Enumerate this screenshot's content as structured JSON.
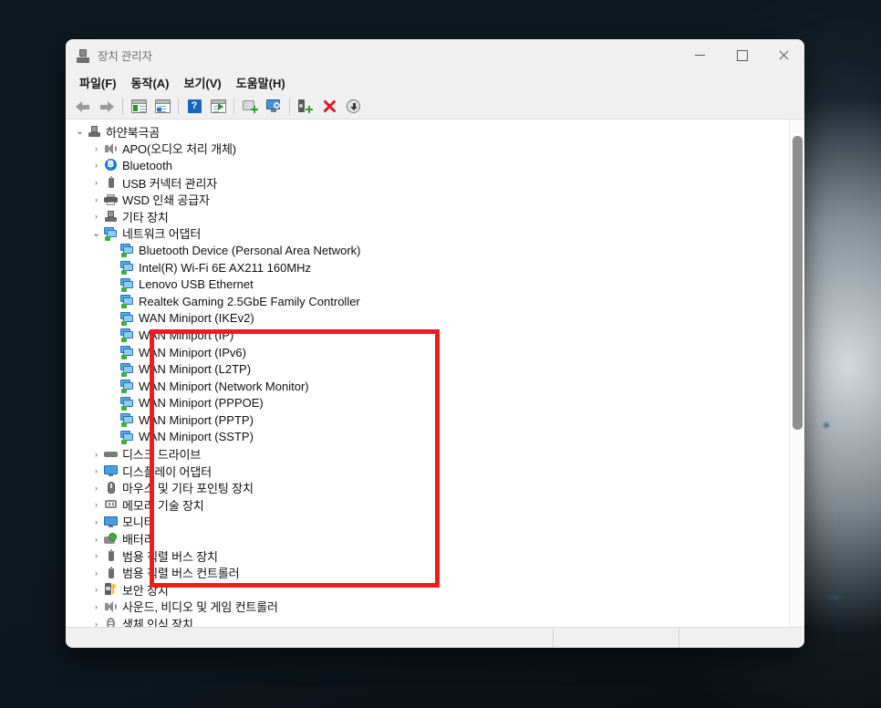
{
  "window": {
    "title": "장치 관리자",
    "title_icon": "device-manager-icon",
    "caption": {
      "minimize_label": "최소화",
      "maximize_label": "최대화",
      "close_label": "닫기"
    }
  },
  "menubar": {
    "items": [
      {
        "label": "파일(F)",
        "name": "menu-file"
      },
      {
        "label": "동작(A)",
        "name": "menu-action"
      },
      {
        "label": "보기(V)",
        "name": "menu-view"
      },
      {
        "label": "도움말(H)",
        "name": "menu-help"
      }
    ]
  },
  "toolbar": {
    "buttons": [
      {
        "icon": "back-arrow-icon",
        "tooltip": "뒤로"
      },
      {
        "icon": "forward-arrow-icon",
        "tooltip": "앞으로"
      },
      {
        "icon": "properties-icon",
        "tooltip": "속성"
      },
      {
        "icon": "update-driver-icon",
        "tooltip": "드라이버 업데이트"
      },
      {
        "icon": "help-icon",
        "tooltip": "도움말"
      },
      {
        "icon": "show-hidden-icon",
        "tooltip": "숨겨진 장치 표시"
      },
      {
        "icon": "scan-hardware-icon",
        "tooltip": "하드웨어 변경 사항 검색"
      },
      {
        "icon": "remote-monitor-icon",
        "tooltip": "다른 컴퓨터에 연결"
      },
      {
        "icon": "uninstall-device-icon",
        "tooltip": "장치 제거"
      },
      {
        "icon": "disable-device-icon",
        "tooltip": "장치 사용 안 함"
      },
      {
        "icon": "enable-device-icon",
        "tooltip": "장치 사용"
      }
    ]
  },
  "tree": {
    "rows": [
      {
        "label": "하얀북극곰",
        "indent": 0,
        "expander": "expanded",
        "icon": "computer-icon"
      },
      {
        "label": "APO(오디오 처리 개체)",
        "indent": 1,
        "expander": "collapsed",
        "icon": "speaker-icon"
      },
      {
        "label": "Bluetooth",
        "indent": 1,
        "expander": "collapsed",
        "icon": "bluetooth-icon",
        "latin": true
      },
      {
        "label": "USB 커넥터 관리자",
        "indent": 1,
        "expander": "collapsed",
        "icon": "usb-icon"
      },
      {
        "label": "WSD 인쇄 공급자",
        "indent": 1,
        "expander": "collapsed",
        "icon": "printer-icon"
      },
      {
        "label": "기타 장치",
        "indent": 1,
        "expander": "collapsed",
        "icon": "computer-icon"
      },
      {
        "label": "네트워크 어댑터",
        "indent": 1,
        "expander": "expanded",
        "icon": "network-adapter-icon"
      },
      {
        "label": "Bluetooth Device (Personal Area Network)",
        "indent": 2,
        "expander": "none",
        "icon": "network-adapter-icon",
        "latin": true
      },
      {
        "label": "Intel(R) Wi-Fi 6E AX211 160MHz",
        "indent": 2,
        "expander": "none",
        "icon": "network-adapter-icon",
        "latin": true
      },
      {
        "label": "Lenovo USB Ethernet",
        "indent": 2,
        "expander": "none",
        "icon": "network-adapter-icon",
        "latin": true
      },
      {
        "label": "Realtek Gaming 2.5GbE Family Controller",
        "indent": 2,
        "expander": "none",
        "icon": "network-adapter-icon",
        "latin": true
      },
      {
        "label": "WAN Miniport (IKEv2)",
        "indent": 2,
        "expander": "none",
        "icon": "network-adapter-icon",
        "latin": true
      },
      {
        "label": "WAN Miniport (IP)",
        "indent": 2,
        "expander": "none",
        "icon": "network-adapter-icon",
        "latin": true
      },
      {
        "label": "WAN Miniport (IPv6)",
        "indent": 2,
        "expander": "none",
        "icon": "network-adapter-icon",
        "latin": true
      },
      {
        "label": "WAN Miniport (L2TP)",
        "indent": 2,
        "expander": "none",
        "icon": "network-adapter-icon",
        "latin": true
      },
      {
        "label": "WAN Miniport (Network Monitor)",
        "indent": 2,
        "expander": "none",
        "icon": "network-adapter-icon",
        "latin": true
      },
      {
        "label": "WAN Miniport (PPPOE)",
        "indent": 2,
        "expander": "none",
        "icon": "network-adapter-icon",
        "latin": true
      },
      {
        "label": "WAN Miniport (PPTP)",
        "indent": 2,
        "expander": "none",
        "icon": "network-adapter-icon",
        "latin": true
      },
      {
        "label": "WAN Miniport (SSTP)",
        "indent": 2,
        "expander": "none",
        "icon": "network-adapter-icon",
        "latin": true
      },
      {
        "label": "디스크 드라이브",
        "indent": 1,
        "expander": "collapsed",
        "icon": "disk-drive-icon"
      },
      {
        "label": "디스플레이 어댑터",
        "indent": 1,
        "expander": "collapsed",
        "icon": "display-adapter-icon"
      },
      {
        "label": "마우스 및 기타 포인팅 장치",
        "indent": 1,
        "expander": "collapsed",
        "icon": "mouse-icon"
      },
      {
        "label": "메모리 기술 장치",
        "indent": 1,
        "expander": "collapsed",
        "icon": "memory-icon"
      },
      {
        "label": "모니터",
        "indent": 1,
        "expander": "collapsed",
        "icon": "display-adapter-icon"
      },
      {
        "label": "배터리",
        "indent": 1,
        "expander": "collapsed",
        "icon": "battery-icon"
      },
      {
        "label": "범용 직렬 버스 장치",
        "indent": 1,
        "expander": "collapsed",
        "icon": "usb-icon"
      },
      {
        "label": "범용 직렬 버스 컨트롤러",
        "indent": 1,
        "expander": "collapsed",
        "icon": "usb-icon"
      },
      {
        "label": "보안 장치",
        "indent": 1,
        "expander": "collapsed",
        "icon": "security-icon"
      },
      {
        "label": "사운드, 비디오 및 게임 컨트롤러",
        "indent": 1,
        "expander": "collapsed",
        "icon": "speaker-icon"
      },
      {
        "label": "생체 인식 장치",
        "indent": 1,
        "expander": "collapsed",
        "icon": "biometric-icon"
      }
    ],
    "expander_collapsed_glyph": "›",
    "expander_expanded_glyph": "⌄"
  },
  "annotation": {
    "name": "red-highlight-rectangle",
    "color": "#ed1c24",
    "covers": "네트워크 어댑터"
  },
  "statusbar": {
    "main_text": "",
    "segment_1": "",
    "segment_2": ""
  },
  "scrollbar": {
    "orientation": "vertical"
  }
}
